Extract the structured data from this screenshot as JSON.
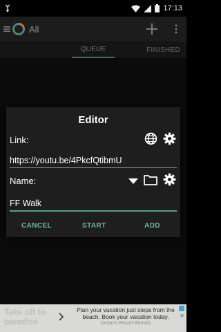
{
  "status_bar": {
    "time": "17:13",
    "icons": [
      "notification-icon",
      "wifi-icon",
      "signal-icon",
      "battery-icon"
    ]
  },
  "app_bar": {
    "title": "All",
    "icons": [
      "menu-icon",
      "app-logo-icon",
      "add-icon",
      "overflow-menu-icon"
    ]
  },
  "tabs": [
    {
      "label": "QUEUE"
    },
    {
      "label": "FINISHED"
    }
  ],
  "dialog": {
    "title": "Editor",
    "link_label": "Link:",
    "link_value": "https://youtu.be/4PkcfQtibmU",
    "name_label": "Name:",
    "name_value": "FF Walk",
    "buttons": {
      "cancel": "CANCEL",
      "start": "START",
      "add": "ADD"
    }
  },
  "ad": {
    "ghost_text": "Take off to\nparadise",
    "line1": "Plan your vacation just steps from the",
    "line2": "beach. Book your vacation today.",
    "brand": "Dreams Resort Rentals"
  },
  "colors": {
    "accent": "#6fb8a6",
    "field_underline_active": "#4fa493",
    "dialog_bg": "#1e1e1e"
  }
}
